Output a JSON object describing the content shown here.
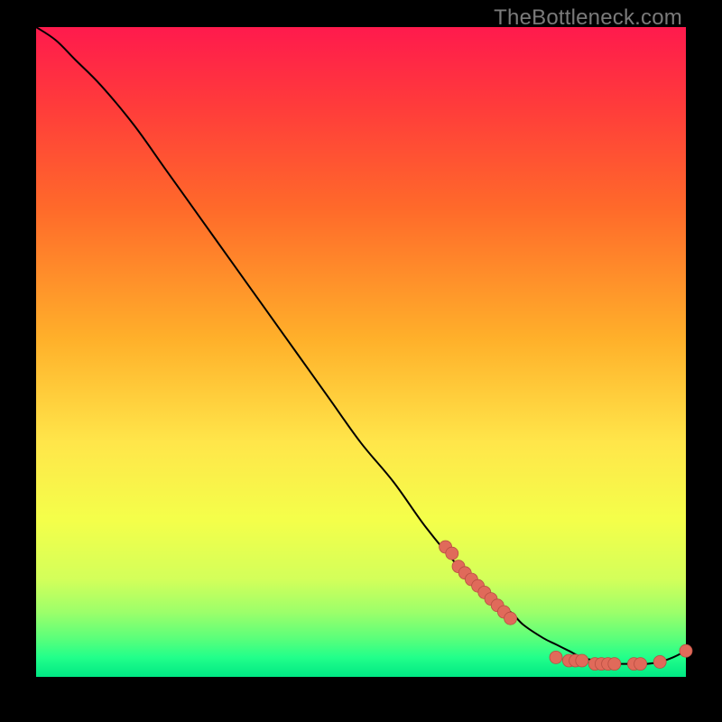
{
  "watermark": "TheBottleneck.com",
  "colors": {
    "line": "#000000",
    "marker_fill": "#e06a5a",
    "marker_stroke": "#b84e42",
    "gradient_top": "#ff1a4d",
    "gradient_mid": "#ffe64a",
    "gradient_bottom": "#00e884"
  },
  "chart_data": {
    "type": "line",
    "title": "",
    "xlabel": "",
    "ylabel": "",
    "xlim": [
      0,
      100
    ],
    "ylim": [
      0,
      100
    ],
    "grid": false,
    "note": "Axes are implied (no tick labels). Values are read as relative 0–100 percent of plot width/height from bottom-left.",
    "series": [
      {
        "name": "curve",
        "kind": "line",
        "x": [
          0,
          3,
          6,
          10,
          15,
          20,
          25,
          30,
          35,
          40,
          45,
          50,
          55,
          60,
          65,
          70,
          73,
          75,
          78,
          80,
          82,
          84,
          86,
          88,
          90,
          92,
          94,
          96,
          98,
          100
        ],
        "y": [
          100,
          98,
          95,
          91,
          85,
          78,
          71,
          64,
          57,
          50,
          43,
          36,
          30,
          23,
          17,
          12,
          10,
          8,
          6,
          5,
          4,
          3,
          2.5,
          2,
          2,
          2,
          2,
          2.3,
          3,
          4
        ]
      },
      {
        "name": "mid-slope-markers",
        "kind": "scatter",
        "x": [
          63,
          64,
          65,
          66,
          67,
          68,
          69,
          70,
          71,
          72,
          73
        ],
        "y": [
          20,
          19,
          17,
          16,
          15,
          14,
          13,
          12,
          11,
          10,
          9
        ]
      },
      {
        "name": "bottom-markers",
        "kind": "scatter",
        "x": [
          80,
          82,
          83,
          84,
          86,
          87,
          88,
          89,
          92,
          93,
          96,
          100
        ],
        "y": [
          3,
          2.5,
          2.5,
          2.5,
          2,
          2,
          2,
          2,
          2,
          2,
          2.3,
          4
        ]
      }
    ]
  }
}
